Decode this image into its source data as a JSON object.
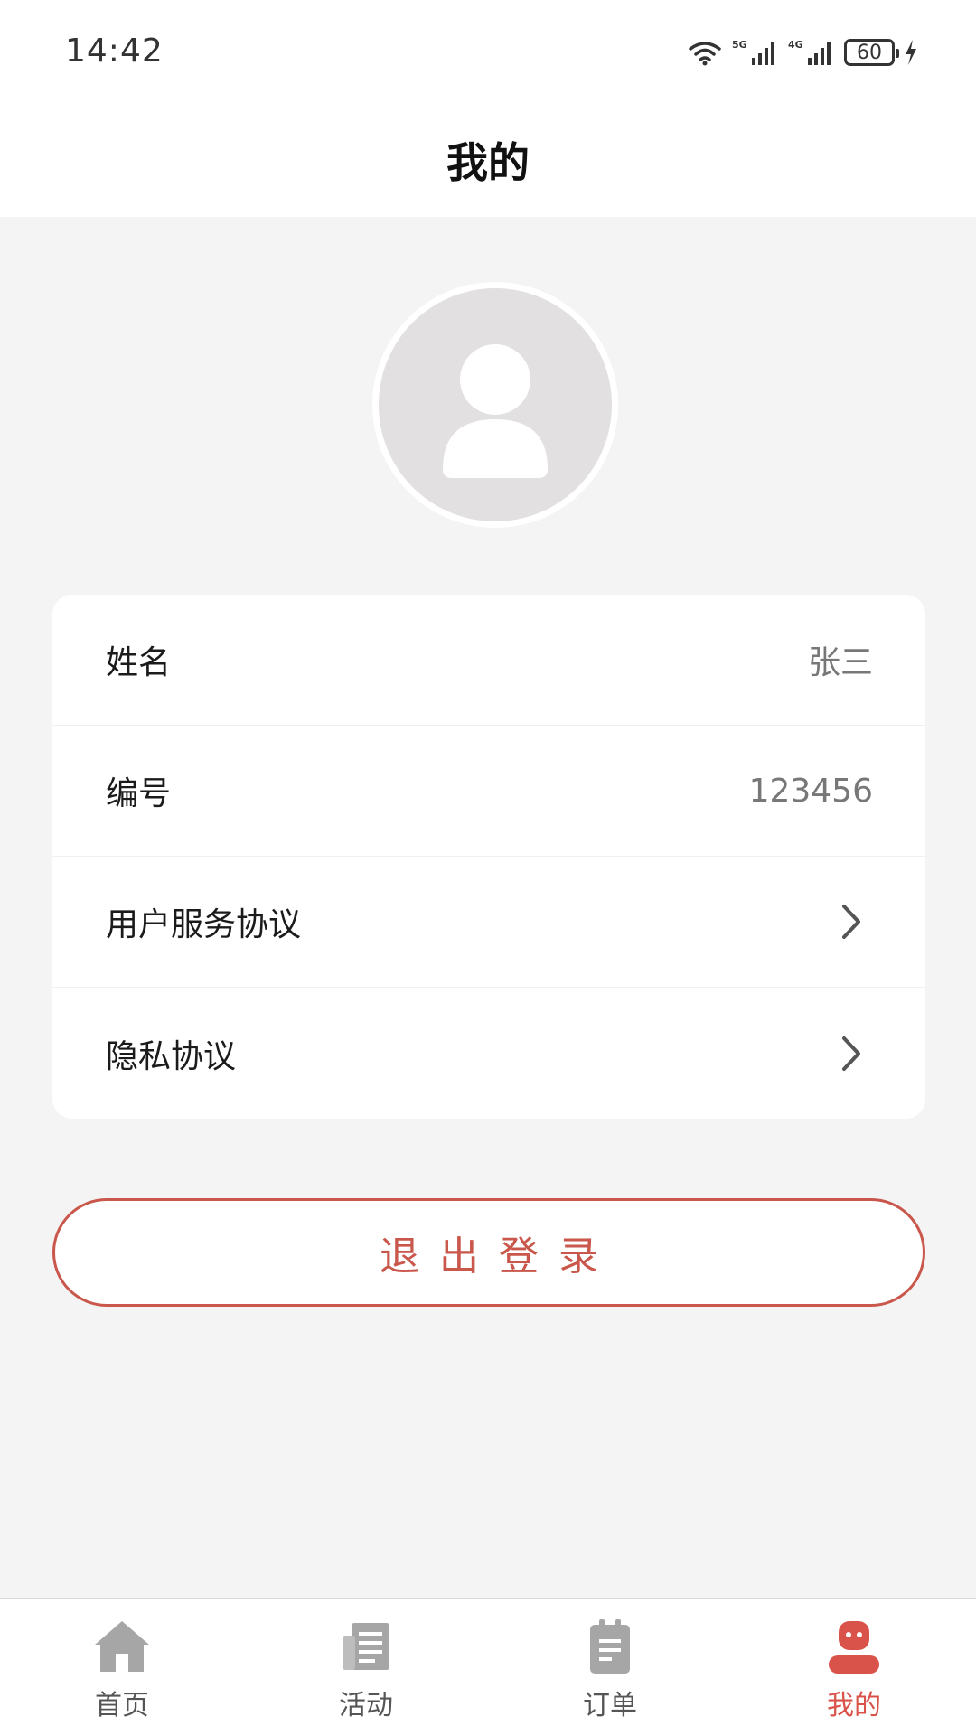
{
  "status_bar": {
    "time": "14:42",
    "battery": "60",
    "network_labels": [
      "5G",
      "4G"
    ]
  },
  "header": {
    "title": "我的"
  },
  "profile": {
    "rows": [
      {
        "label": "姓名",
        "value": "张三"
      },
      {
        "label": "编号",
        "value": "123456"
      },
      {
        "label": "用户服务协议"
      },
      {
        "label": "隐私协议"
      }
    ]
  },
  "logout": {
    "label": "退出登录"
  },
  "tabbar": {
    "tabs": [
      {
        "label": "首页",
        "icon": "home-icon"
      },
      {
        "label": "活动",
        "icon": "news-icon"
      },
      {
        "label": "订单",
        "icon": "clipboard-icon"
      },
      {
        "label": "我的",
        "icon": "user-icon"
      }
    ],
    "active_index": 3
  },
  "colors": {
    "accent": "#c9574b",
    "tab_active": "#d9534a",
    "tab_inactive": "#a6a6a6",
    "background": "#f4f4f4"
  }
}
